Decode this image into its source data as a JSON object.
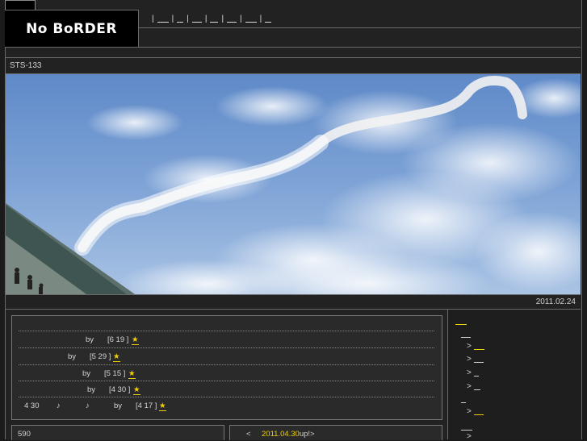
{
  "header": {
    "logo_text": "No BoRDER",
    "nav": [
      "|",
      "|",
      "|",
      "|",
      "|",
      "|"
    ]
  },
  "post": {
    "title": "STS-133",
    "date": "2011.02.24"
  },
  "entries": [
    {
      "by": "by",
      "date": "[6 19 ]",
      "star": "★"
    },
    {
      "by": "by",
      "date": "[5 29 ]",
      "star": "★"
    },
    {
      "by": "by",
      "date": "[5 15 ]",
      "star": "★"
    },
    {
      "by": "by",
      "date": "[4 30 ]",
      "star": "★"
    },
    {
      "prefix": "4 30",
      "note1": "♪",
      "note2": "♪",
      "by": "by",
      "date": "[4 17 ]",
      "star": "★"
    }
  ],
  "sidebar": {
    "arrows": [
      ">",
      ">",
      ">",
      ">",
      ">",
      ">"
    ]
  },
  "box_count": "590",
  "update": {
    "arrow": "<",
    "date": "2011.04.30",
    "suffix": "up!>"
  },
  "colors": {
    "accent": "#f0d000",
    "background": "#222222",
    "border": "#6a6a6a"
  }
}
